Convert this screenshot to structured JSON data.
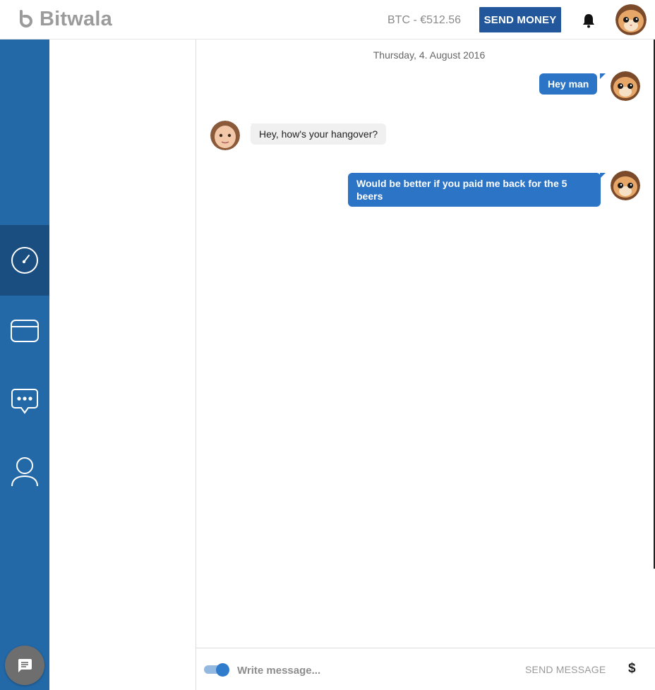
{
  "header": {
    "logo_text": "Bitwala",
    "balance": "BTC - €512.56",
    "send_money_label": "SEND MONEY"
  },
  "sidebar": {
    "items": [
      {
        "icon": "dashboard-gauge-icon",
        "active": true
      },
      {
        "icon": "card-icon",
        "active": false
      },
      {
        "icon": "chat-bubble-icon",
        "active": false
      },
      {
        "icon": "user-icon",
        "active": false
      }
    ],
    "fab_icon": "message-icon"
  },
  "chat": {
    "date": "Thursday, 4. August 2016",
    "messages": [
      {
        "direction": "out",
        "text": "Hey man"
      },
      {
        "direction": "in",
        "text": "Hey, how's your hangover?"
      },
      {
        "direction": "out",
        "text": "Would be better if you paid me back for the 5 beers"
      }
    ]
  },
  "composer": {
    "placeholder": "Write message...",
    "send_label": "SEND MESSAGE",
    "currency_symbol": "$"
  },
  "colors": {
    "brand_blue": "#22589b",
    "sidebar_blue": "#2369a8",
    "sidebar_active": "#1a4e80",
    "bubble_out": "#2b74c6",
    "bubble_in": "#f0f0f0"
  }
}
